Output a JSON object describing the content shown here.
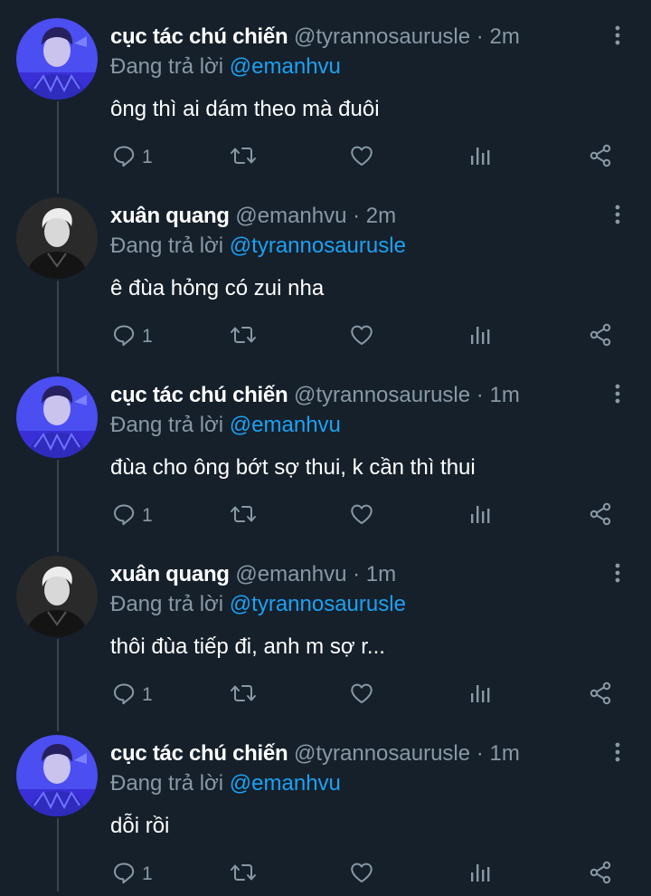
{
  "reply_prefix": "Đang trả lời",
  "tweets": [
    {
      "name": "cục tác chú chiến",
      "handle": "@tyrannosaurusle",
      "separator": "·",
      "time": "2m",
      "reply_to": "@emanhvu",
      "text": "ông thì ai dám theo mà đuôi",
      "reply_count": "1",
      "avatar": "blue"
    },
    {
      "name": "xuân quang",
      "handle": "@emanhvu",
      "separator": "·",
      "time": "2m",
      "reply_to": "@tyrannosaurusle",
      "text": "ê đùa hỏng có zui nha",
      "reply_count": "1",
      "avatar": "dark"
    },
    {
      "name": "cục tác chú chiến",
      "handle": "@tyrannosaurusle",
      "separator": "·",
      "time": "1m",
      "reply_to": "@emanhvu",
      "text": "đùa cho ông bớt sợ thui, k cần thì thui",
      "reply_count": "1",
      "avatar": "blue"
    },
    {
      "name": "xuân quang",
      "handle": "@emanhvu",
      "separator": "·",
      "time": "1m",
      "reply_to": "@tyrannosaurusle",
      "text": "thôi đùa tiếp đi, anh m sợ r...",
      "reply_count": "1",
      "avatar": "dark"
    },
    {
      "name": "cục tác chú chiến",
      "handle": "@tyrannosaurusle",
      "separator": "·",
      "time": "1m",
      "reply_to": "@emanhvu",
      "text": "dỗi rồi",
      "reply_count": "1",
      "avatar": "blue"
    }
  ],
  "icons": {
    "reply": "reply-icon",
    "retweet": "retweet-icon",
    "like": "like-icon",
    "analytics": "analytics-icon",
    "share": "share-icon",
    "more": "more-icon"
  },
  "colors": {
    "background": "#15202b",
    "muted": "#8899a6",
    "link": "#1da1f2",
    "thread_line": "#38444d",
    "avatar_blue": "#3f3fe8",
    "avatar_dark": "#2a2a2a"
  }
}
